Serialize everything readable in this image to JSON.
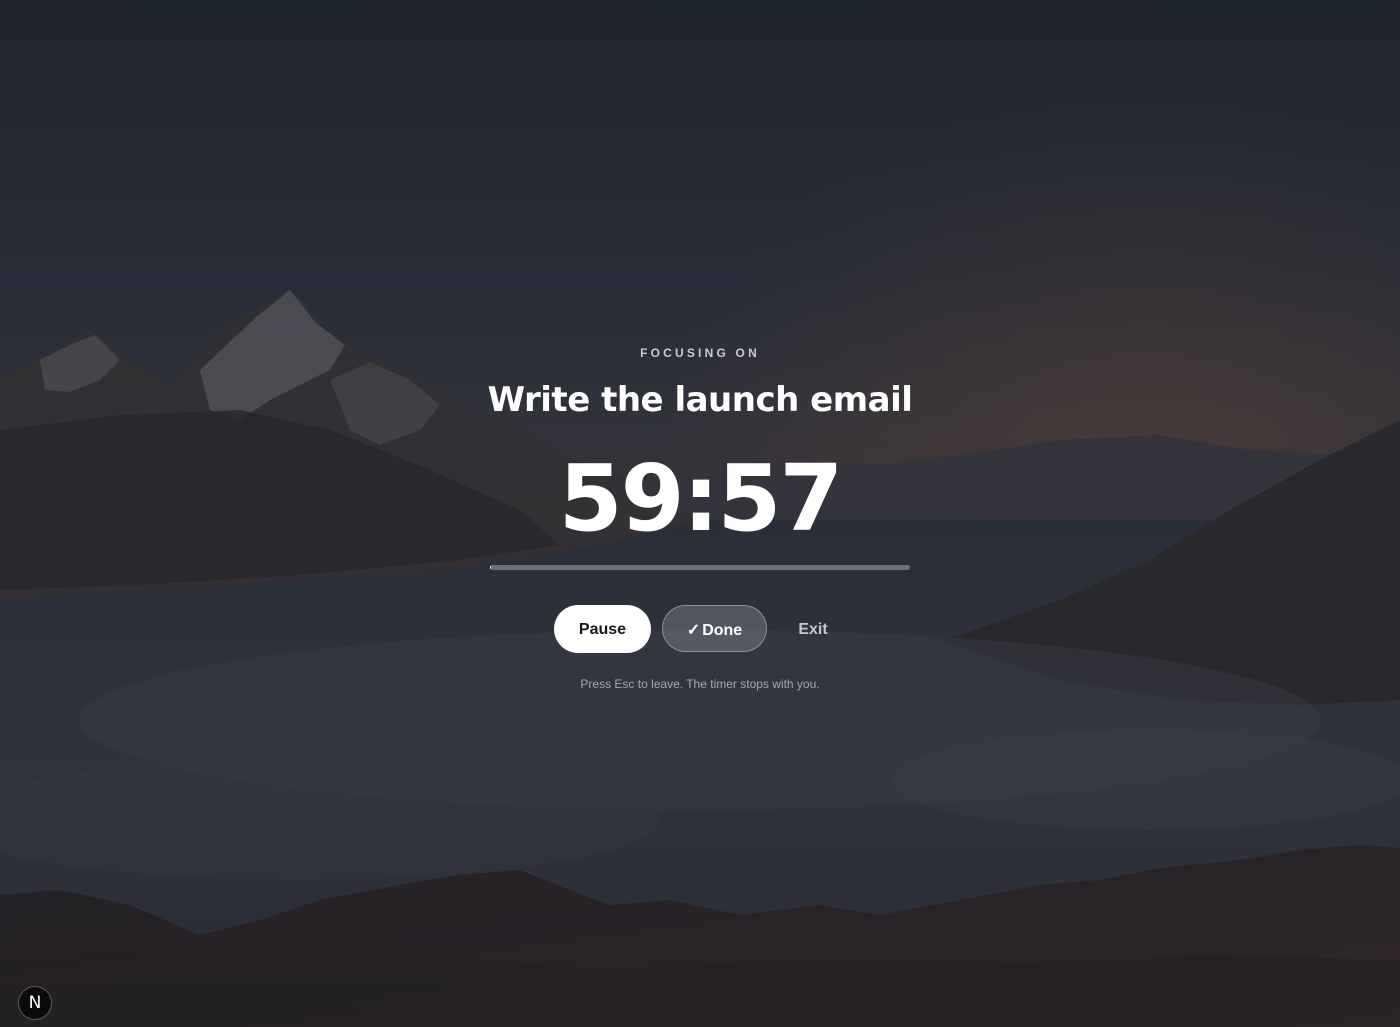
{
  "focus": {
    "eyebrow": "FOCUSING ON",
    "task_title": "Write the launch email",
    "timer": "59:57",
    "progress_fraction": 0.001
  },
  "controls": {
    "pause_label": "Pause",
    "done_icon": "checkmark-icon",
    "done_glyph": "✓",
    "done_label": "Done",
    "exit_label": "Exit"
  },
  "hint": "Press Esc to leave. The timer stops with you.",
  "badge": {
    "icon": "n-logo-icon",
    "letter": "N"
  },
  "colors": {
    "background_dark": "#22262f",
    "primary_button_bg": "#ffffff",
    "text_primary": "#ffffff",
    "text_muted": "#a4a8b2"
  }
}
